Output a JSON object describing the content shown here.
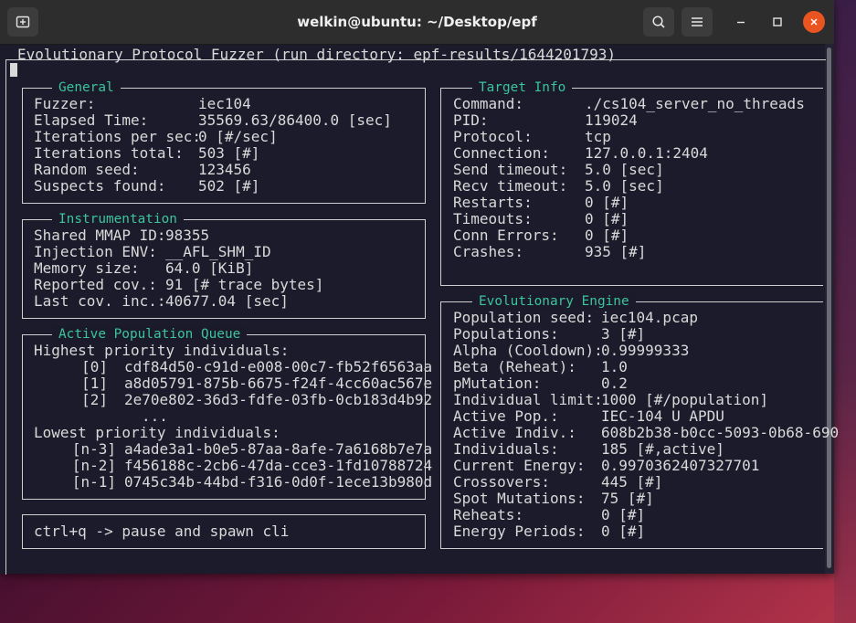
{
  "window": {
    "title": "welkin@ubuntu: ~/Desktop/epf",
    "accent_close": "#e95420"
  },
  "header": {
    "text": "Evolutionary Protocol Fuzzer (run directory: epf-results/1644201793)"
  },
  "general": {
    "title": "General",
    "rows": [
      {
        "k": "Fuzzer:",
        "v": "iec104"
      },
      {
        "k": "Elapsed Time:",
        "v": "35569.63/86400.0 [sec]"
      },
      {
        "k": "Iterations per sec:",
        "v": "0 [#/sec]"
      },
      {
        "k": "Iterations total:",
        "v": "503 [#]"
      },
      {
        "k": "Random seed:",
        "v": "123456"
      },
      {
        "k": "Suspects found:",
        "v": "502 [#]"
      }
    ]
  },
  "instrumentation": {
    "title": "Instrumentation",
    "rows": [
      {
        "k": "Shared MMAP ID:",
        "v": "98355"
      },
      {
        "k": "Injection ENV:",
        "v": "__AFL_SHM_ID"
      },
      {
        "k": "Memory size:",
        "v": "64.0 [KiB]"
      },
      {
        "k": "Reported cov.:",
        "v": "91 [# trace bytes]"
      },
      {
        "k": "Last cov. inc.:",
        "v": "40677.04 [sec]"
      }
    ]
  },
  "queue": {
    "title": "Active Population Queue",
    "highest_label": "Highest priority individuals:",
    "highest": [
      {
        "i": "[0]",
        "id": "cdf84d50-c91d-e008-00c7-fb52f6563aa"
      },
      {
        "i": "[1]",
        "id": "a8d05791-875b-6675-f24f-4cc60ac567e"
      },
      {
        "i": "[2]",
        "id": "2e70e802-36d3-fdfe-03fb-0cb183d4b92"
      }
    ],
    "ellipsis": "...",
    "lowest_label": "Lowest priority individuals:",
    "lowest": [
      {
        "i": "[n-3]",
        "id": "a4ade3a1-b0e5-87aa-8afe-7a6168b7e7a"
      },
      {
        "i": "[n-2]",
        "id": "f456188c-2cb6-47da-cce3-1fd10788724"
      },
      {
        "i": "[n-1]",
        "id": "0745c34b-44bd-f316-0d0f-1ece13b980d"
      }
    ]
  },
  "hint": {
    "text": "ctrl+q -> pause and spawn cli"
  },
  "target": {
    "title": "Target Info",
    "rows": [
      {
        "k": "Command:",
        "v": "./cs104_server_no_threads"
      },
      {
        "k": "PID:",
        "v": "119024"
      },
      {
        "k": "Protocol:",
        "v": "tcp"
      },
      {
        "k": "Connection:",
        "v": "127.0.0.1:2404"
      },
      {
        "k": "Send timeout:",
        "v": "5.0 [sec]"
      },
      {
        "k": "Recv timeout:",
        "v": "5.0 [sec]"
      },
      {
        "k": "Restarts:",
        "v": "0 [#]"
      },
      {
        "k": "Timeouts:",
        "v": "0 [#]"
      },
      {
        "k": "Conn Errors:",
        "v": "0 [#]"
      },
      {
        "k": "Crashes:",
        "v": "935 [#]"
      }
    ]
  },
  "engine": {
    "title": "Evolutionary Engine",
    "rows": [
      {
        "k": "Population seed:",
        "v": "iec104.pcap"
      },
      {
        "k": "Populations:",
        "v": "3 [#]"
      },
      {
        "k": "Alpha (Cooldown):",
        "v": "0.99999333"
      },
      {
        "k": "Beta (Reheat):",
        "v": "1.0"
      },
      {
        "k": "pMutation:",
        "v": "0.2"
      },
      {
        "k": "Individual limit:",
        "v": "1000 [#/population]"
      },
      {
        "k": "Active Pop.:",
        "v": "IEC-104 U APDU"
      },
      {
        "k": "Active Indiv.:",
        "v": "608b2b38-b0cc-5093-0b68-690"
      },
      {
        "k": "Individuals:",
        "v": "185 [#,active]"
      },
      {
        "k": "Current Energy:",
        "v": "0.9970362407327701"
      },
      {
        "k": "Crossovers:",
        "v": "445 [#]"
      },
      {
        "k": "Spot Mutations:",
        "v": "75 [#]"
      },
      {
        "k": "Reheats:",
        "v": "0 [#]"
      },
      {
        "k": "Energy Periods:",
        "v": "0 [#]"
      }
    ]
  }
}
